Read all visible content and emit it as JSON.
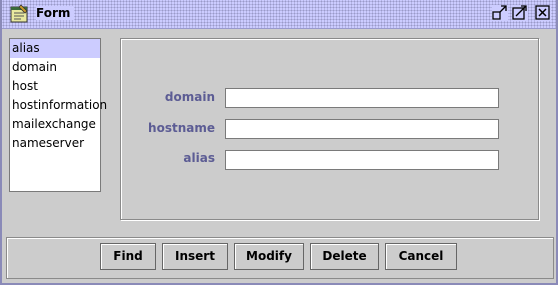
{
  "window": {
    "title": "Form",
    "icon": "form-notepad-icon",
    "controls": [
      "minimize-icon",
      "maximize-icon",
      "close-icon"
    ]
  },
  "list": {
    "items": [
      "alias",
      "domain",
      "host",
      "hostinformation",
      "mailexchange",
      "nameserver"
    ],
    "selected": "alias"
  },
  "form": {
    "fields": [
      {
        "label": "domain",
        "value": ""
      },
      {
        "label": "hostname",
        "value": ""
      },
      {
        "label": "alias",
        "value": ""
      }
    ]
  },
  "buttons": {
    "find": "Find",
    "insert": "Insert",
    "modify": "Modify",
    "delete": "Delete",
    "cancel": "Cancel"
  },
  "colors": {
    "title_bar": "#ccccff",
    "selection": "#ccccff",
    "label_text": "#5c5c94",
    "background": "#cccccc"
  }
}
